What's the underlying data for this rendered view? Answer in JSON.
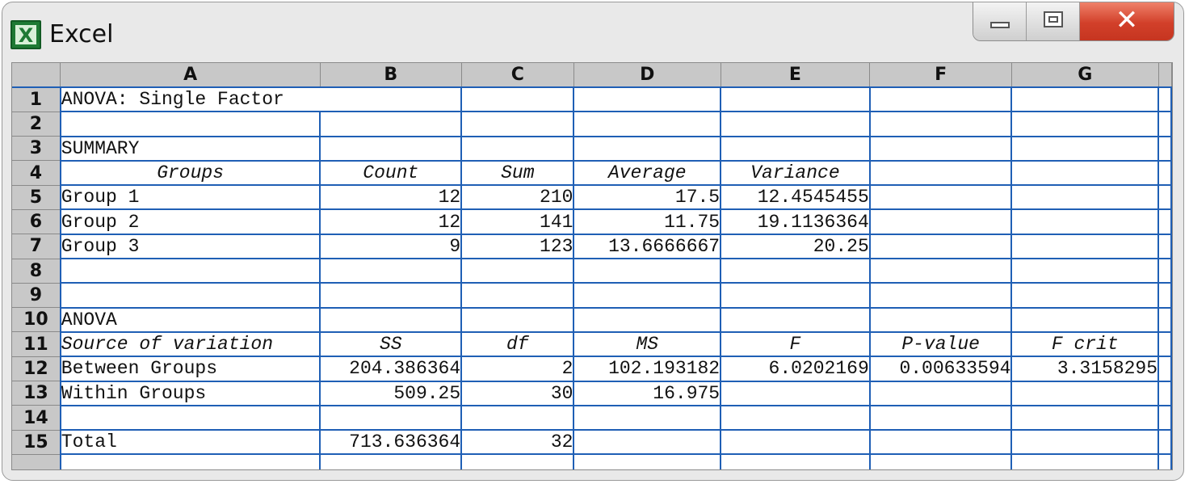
{
  "window": {
    "title": "Excel",
    "icon": "excel-icon"
  },
  "window_controls": [
    "minimize-icon",
    "maximize-icon",
    "close-icon"
  ],
  "columns": [
    "A",
    "B",
    "C",
    "D",
    "E",
    "F",
    "G"
  ],
  "rows": [
    "1",
    "2",
    "3",
    "4",
    "5",
    "6",
    "7",
    "8",
    "9",
    "10",
    "11",
    "12",
    "13",
    "14",
    "15"
  ],
  "cells": {
    "r1": {
      "A": "ANOVA: Single Factor"
    },
    "r3": {
      "A": "SUMMARY"
    },
    "r4": {
      "A": "Groups",
      "B": "Count",
      "C": "Sum",
      "D": "Average",
      "E": "Variance"
    },
    "r5": {
      "A": "Group 1",
      "B": "12",
      "C": "210",
      "D": "17.5",
      "E": "12.4545455"
    },
    "r6": {
      "A": "Group 2",
      "B": "12",
      "C": "141",
      "D": "11.75",
      "E": "19.1136364"
    },
    "r7": {
      "A": "Group 3",
      "B": "9",
      "C": "123",
      "D": "13.6666667",
      "E": "20.25"
    },
    "r10": {
      "A": "ANOVA"
    },
    "r11": {
      "A": "Source of variation",
      "B": "SS",
      "C": "df",
      "D": "MS",
      "E": "F",
      "F": "P-value",
      "G": "F crit"
    },
    "r12": {
      "A": "Between Groups",
      "B": "204.386364",
      "C": "2",
      "D": "102.193182",
      "E": "6.0202169",
      "F": "0.00633594",
      "G": "3.3158295"
    },
    "r13": {
      "A": "Within Groups",
      "B": "509.25",
      "C": "30",
      "D": "16.975"
    },
    "r15": {
      "A": "Total",
      "B": "713.636364",
      "C": "32"
    }
  }
}
